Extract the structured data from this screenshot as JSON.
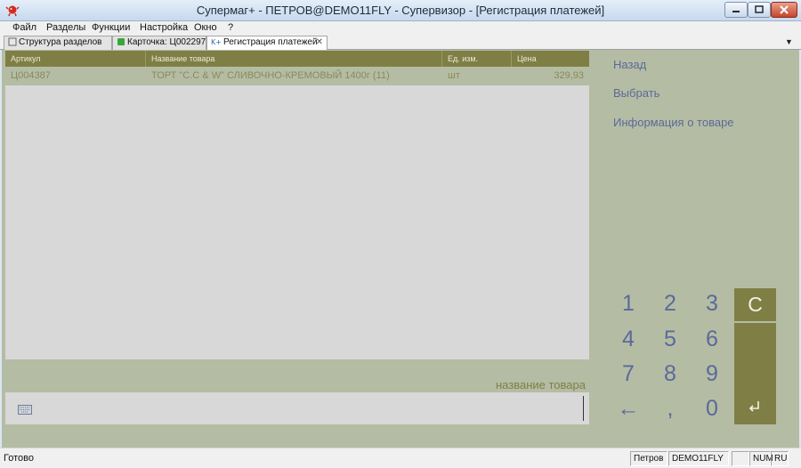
{
  "window": {
    "title": "Супермаг+ - ПЕТРОВ@DEMO11FLY - Супервизор  - [Регистрация платежей]"
  },
  "menu": [
    "Файл",
    "Разделы",
    "Функции",
    "Настройка",
    "Окно",
    "?"
  ],
  "tabs": [
    {
      "label": "Структура разделов",
      "icon": "structure-icon"
    },
    {
      "label": "Карточка: Ц002297",
      "icon": "card-icon"
    },
    {
      "label": "Регистрация платежей",
      "icon": "payment-icon",
      "close": "✕"
    }
  ],
  "grid": {
    "columns": [
      "Артикул",
      "Название товара",
      "Ед. изм.",
      "Цена"
    ],
    "rows": [
      {
        "article": "Ц004387",
        "name": "ТОРТ \"С.С & W\" СЛИВОЧНО-КРЕМОВЫЙ  1400г (11)",
        "unit": "шт",
        "price": "329,93"
      }
    ]
  },
  "search": {
    "label": "название товара",
    "value": ""
  },
  "actions": {
    "back": "Назад",
    "select": "Выбрать",
    "info": "Информация о товаре"
  },
  "keypad": {
    "k1": "1",
    "k2": "2",
    "k3": "3",
    "k4": "4",
    "k5": "5",
    "k6": "6",
    "k7": "7",
    "k8": "8",
    "k9": "9",
    "back": "←",
    "comma": ",",
    "k0": "0",
    "clear": "C",
    "enter": "enter-icon"
  },
  "status": {
    "text": "Готово",
    "user": "Петров",
    "db": "DEMO11FLY",
    "empty": "",
    "num": "NUM",
    "lang": "RU"
  },
  "colors": {
    "accent": "#7f7f45",
    "panel": "#b5bca4",
    "link": "#5a6a9a"
  }
}
